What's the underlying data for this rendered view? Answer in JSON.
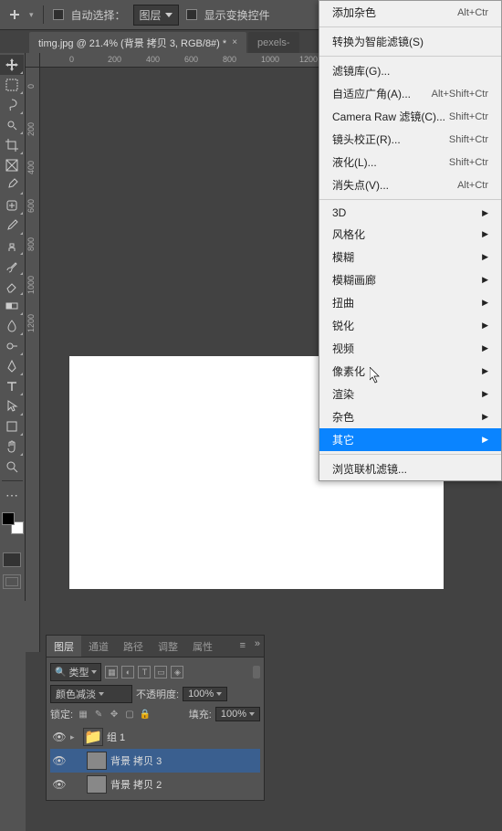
{
  "options_bar": {
    "auto_select_label": "自动选择：",
    "auto_select_target": "图层",
    "show_transform_label": "显示变换控件"
  },
  "tabs": {
    "active": "timg.jpg @ 21.4% (背景 拷贝 3, RGB/8#) *",
    "inactive": "pexels-"
  },
  "ruler": {
    "h": [
      "0",
      "200",
      "400",
      "600",
      "800",
      "1000",
      "1200"
    ],
    "v": [
      "0",
      "200",
      "400",
      "600",
      "800",
      "1000",
      "1200"
    ]
  },
  "menu": {
    "items": [
      {
        "label": "添加杂色",
        "shortcut": "Alt+Ctr",
        "type": "item"
      },
      {
        "type": "sep"
      },
      {
        "label": "转换为智能滤镜(S)",
        "type": "item"
      },
      {
        "type": "sep"
      },
      {
        "label": "滤镜库(G)...",
        "type": "item"
      },
      {
        "label": "自适应广角(A)...",
        "shortcut": "Alt+Shift+Ctr",
        "type": "item"
      },
      {
        "label": "Camera Raw 滤镜(C)...",
        "shortcut": "Shift+Ctr",
        "type": "item"
      },
      {
        "label": "镜头校正(R)...",
        "shortcut": "Shift+Ctr",
        "type": "item"
      },
      {
        "label": "液化(L)...",
        "shortcut": "Shift+Ctr",
        "type": "item"
      },
      {
        "label": "消失点(V)...",
        "shortcut": "Alt+Ctr",
        "type": "item"
      },
      {
        "type": "sep"
      },
      {
        "label": "3D",
        "type": "submenu"
      },
      {
        "label": "风格化",
        "type": "submenu"
      },
      {
        "label": "模糊",
        "type": "submenu"
      },
      {
        "label": "模糊画廊",
        "type": "submenu"
      },
      {
        "label": "扭曲",
        "type": "submenu"
      },
      {
        "label": "锐化",
        "type": "submenu"
      },
      {
        "label": "视频",
        "type": "submenu"
      },
      {
        "label": "像素化",
        "type": "submenu"
      },
      {
        "label": "渲染",
        "type": "submenu"
      },
      {
        "label": "杂色",
        "type": "submenu"
      },
      {
        "label": "其它",
        "type": "submenu",
        "highlighted": true
      },
      {
        "type": "sep"
      },
      {
        "label": "浏览联机滤镜...",
        "type": "item"
      }
    ]
  },
  "layers_panel": {
    "tabs": [
      "图层",
      "通道",
      "路径",
      "调整",
      "属性"
    ],
    "kind_label": "类型",
    "blend_mode": "颜色减淡",
    "opacity_label": "不透明度:",
    "opacity_value": "100%",
    "lock_label": "锁定:",
    "fill_label": "填充:",
    "fill_value": "100%",
    "layers": [
      {
        "name": "组 1",
        "group": true
      },
      {
        "name": "背景 拷贝 3",
        "selected": true
      },
      {
        "name": "背景 拷贝 2"
      }
    ]
  }
}
